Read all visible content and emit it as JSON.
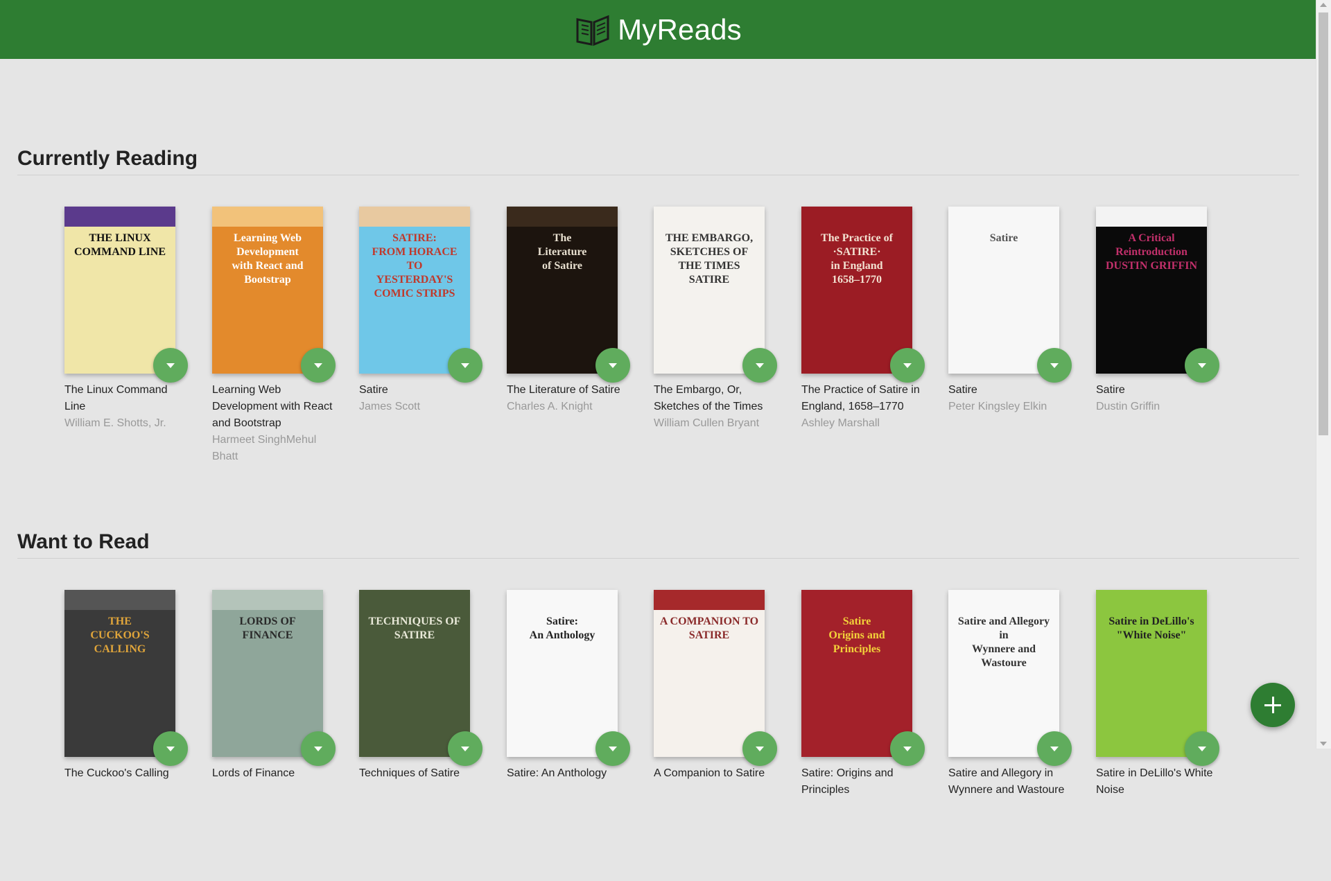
{
  "header": {
    "title": "MyReads",
    "logo_icon": "open-book-icon",
    "bg": "#2e7d32"
  },
  "shelves": [
    {
      "title": "Currently Reading",
      "books": [
        {
          "title": "The Linux Command Line",
          "authors": "William E. Shotts, Jr.",
          "cover": {
            "bg": "#f0e6a8",
            "top": "#5b3a8c",
            "lines": [
              "THE LINUX",
              "COMMAND LINE"
            ],
            "fg": "#111"
          }
        },
        {
          "title": "Learning Web Development with React and Bootstrap",
          "authors": "Harmeet SinghMehul Bhatt",
          "cover": {
            "bg": "#e38a2c",
            "top": "#f2c27a",
            "lines": [
              "Learning Web Development",
              "with React and Bootstrap"
            ],
            "fg": "#fff"
          }
        },
        {
          "title": "Satire",
          "authors": "James Scott",
          "cover": {
            "bg": "#6fc7e8",
            "top": "#e8c9a0",
            "lines": [
              "SATIRE:",
              "FROM HORACE TO",
              "YESTERDAY'S",
              "COMIC STRIPS"
            ],
            "fg": "#c0392b"
          }
        },
        {
          "title": "The Literature of Satire",
          "authors": "Charles A. Knight",
          "cover": {
            "bg": "#1c140e",
            "top": "#3a2a1c",
            "lines": [
              "The",
              "Literature",
              "of Satire"
            ],
            "fg": "#e8e0d0"
          }
        },
        {
          "title": "The Embargo, Or, Sketches of the Times",
          "authors": "William Cullen Bryant",
          "cover": {
            "bg": "#f4f2ee",
            "top": "#f4f2ee",
            "lines": [
              "THE EMBARGO,",
              "SKETCHES OF THE TIMES",
              "SATIRE"
            ],
            "fg": "#333"
          }
        },
        {
          "title": "The Practice of Satire in England, 1658–1770",
          "authors": "Ashley Marshall",
          "cover": {
            "bg": "#9b1c24",
            "top": "#9b1c24",
            "lines": [
              "The Practice of",
              "·SATIRE·",
              "in England",
              "1658–1770"
            ],
            "fg": "#f3e2d2"
          }
        },
        {
          "title": "Satire",
          "authors": "Peter Kingsley Elkin",
          "cover": {
            "bg": "#f7f7f7",
            "top": "#f7f7f7",
            "lines": [
              "Satire"
            ],
            "fg": "#555"
          }
        },
        {
          "title": "Satire",
          "authors": "Dustin Griffin",
          "cover": {
            "bg": "#0a0a0a",
            "top": "#f3f3f3",
            "lines": [
              "A Critical",
              "Reintroduction",
              "DUSTIN GRIFFIN"
            ],
            "fg": "#c2306b"
          }
        }
      ]
    },
    {
      "title": "Want to Read",
      "books": [
        {
          "title": "The Cuckoo's Calling",
          "authors": "",
          "cover": {
            "bg": "#3a3a3a",
            "top": "#555",
            "lines": [
              "THE",
              "CUCKOO'S",
              "CALLING"
            ],
            "fg": "#e0a53a"
          }
        },
        {
          "title": "Lords of Finance",
          "authors": "",
          "cover": {
            "bg": "#8fa69a",
            "top": "#b4c4ba",
            "lines": [
              "LORDS OF FINANCE"
            ],
            "fg": "#2a2a2a"
          }
        },
        {
          "title": "Techniques of Satire",
          "authors": "",
          "cover": {
            "bg": "#4a5a3a",
            "top": "#4a5a3a",
            "lines": [
              "TECHNIQUES OF",
              "SATIRE"
            ],
            "fg": "#e8e8d8"
          }
        },
        {
          "title": "Satire: An Anthology",
          "authors": "",
          "cover": {
            "bg": "#f8f8f8",
            "top": "#f8f8f8",
            "lines": [
              "Satire:",
              "An Anthology"
            ],
            "fg": "#222"
          }
        },
        {
          "title": "A Companion to Satire",
          "authors": "",
          "cover": {
            "bg": "#f5f1ec",
            "top": "#a6292b",
            "lines": [
              "A COMPANION TO",
              "SATIRE"
            ],
            "fg": "#8a2a2a"
          }
        },
        {
          "title": "Satire: Origins and Principles",
          "authors": "",
          "cover": {
            "bg": "#a3212a",
            "top": "#a3212a",
            "lines": [
              "Satire",
              "Origins and Principles"
            ],
            "fg": "#f3d23a"
          }
        },
        {
          "title": "Satire and Allegory in Wynnere and Wastoure",
          "authors": "",
          "cover": {
            "bg": "#f8f8f8",
            "top": "#f8f8f8",
            "lines": [
              "Satire and Allegory in",
              "Wynnere and Wastoure"
            ],
            "fg": "#333"
          }
        },
        {
          "title": "Satire in DeLillo's White Noise",
          "authors": "",
          "cover": {
            "bg": "#8cc63f",
            "top": "#8cc63f",
            "lines": [
              "Satire in DeLillo's \"White Noise\""
            ],
            "fg": "#222"
          }
        }
      ]
    }
  ],
  "fab": {
    "icon": "plus-icon",
    "label": "Add a book"
  }
}
